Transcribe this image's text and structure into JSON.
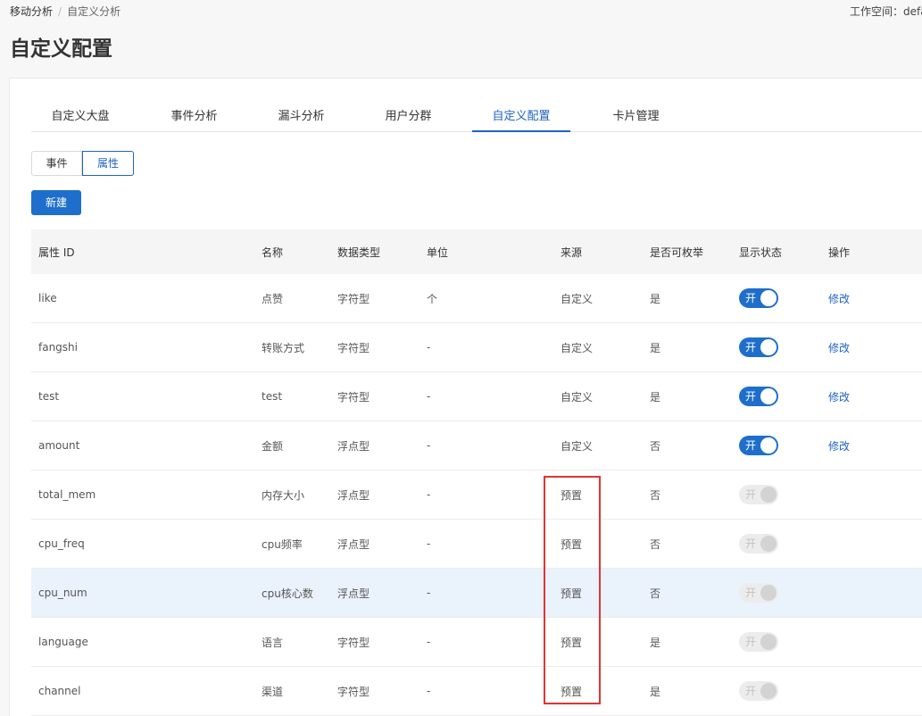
{
  "breadcrumb": {
    "root": "移动分析",
    "separator": "/",
    "current": "自定义分析"
  },
  "workspace": "工作空间：defa",
  "page_title": "自定义配置",
  "tabs": [
    "自定义大盘",
    "事件分析",
    "漏斗分析",
    "用户分群",
    "自定义配置",
    "卡片管理"
  ],
  "active_tab": 4,
  "segment": {
    "event": "事件",
    "attribute": "属性",
    "selected": "attribute"
  },
  "new_button": "新建",
  "table": {
    "headers": [
      "属性 ID",
      "名称",
      "数据类型",
      "单位",
      "来源",
      "是否可枚举",
      "显示状态",
      "操作"
    ],
    "rows": [
      {
        "id": "like",
        "name": "点赞",
        "type": "字符型",
        "unit": "个",
        "source": "自定义",
        "enumerable": "是",
        "status": "开",
        "enabled": true,
        "action": "修改"
      },
      {
        "id": "fangshi",
        "name": "转账方式",
        "type": "字符型",
        "unit": "-",
        "source": "自定义",
        "enumerable": "是",
        "status": "开",
        "enabled": true,
        "action": "修改"
      },
      {
        "id": "test",
        "name": "test",
        "type": "字符型",
        "unit": "-",
        "source": "自定义",
        "enumerable": "是",
        "status": "开",
        "enabled": true,
        "action": "修改"
      },
      {
        "id": "amount",
        "name": "金额",
        "type": "浮点型",
        "unit": "-",
        "source": "自定义",
        "enumerable": "否",
        "status": "开",
        "enabled": true,
        "action": "修改"
      },
      {
        "id": "total_mem",
        "name": "内存大小",
        "type": "浮点型",
        "unit": "-",
        "source": "预置",
        "enumerable": "否",
        "status": "开",
        "enabled": false,
        "action": ""
      },
      {
        "id": "cpu_freq",
        "name": "cpu频率",
        "type": "浮点型",
        "unit": "-",
        "source": "预置",
        "enumerable": "否",
        "status": "开",
        "enabled": false,
        "action": ""
      },
      {
        "id": "cpu_num",
        "name": "cpu核心数",
        "type": "浮点型",
        "unit": "-",
        "source": "预置",
        "enumerable": "否",
        "status": "开",
        "enabled": false,
        "action": "",
        "highlighted": true
      },
      {
        "id": "language",
        "name": "语言",
        "type": "字符型",
        "unit": "-",
        "source": "预置",
        "enumerable": "是",
        "status": "开",
        "enabled": false,
        "action": ""
      },
      {
        "id": "channel",
        "name": "渠道",
        "type": "字符型",
        "unit": "-",
        "source": "预置",
        "enumerable": "是",
        "status": "开",
        "enabled": false,
        "action": ""
      }
    ]
  },
  "colors": {
    "primary": "#1e6fcc",
    "link": "#1e62c3",
    "highlight_row": "#eaf2fb",
    "annotation_box": "#e03434"
  }
}
